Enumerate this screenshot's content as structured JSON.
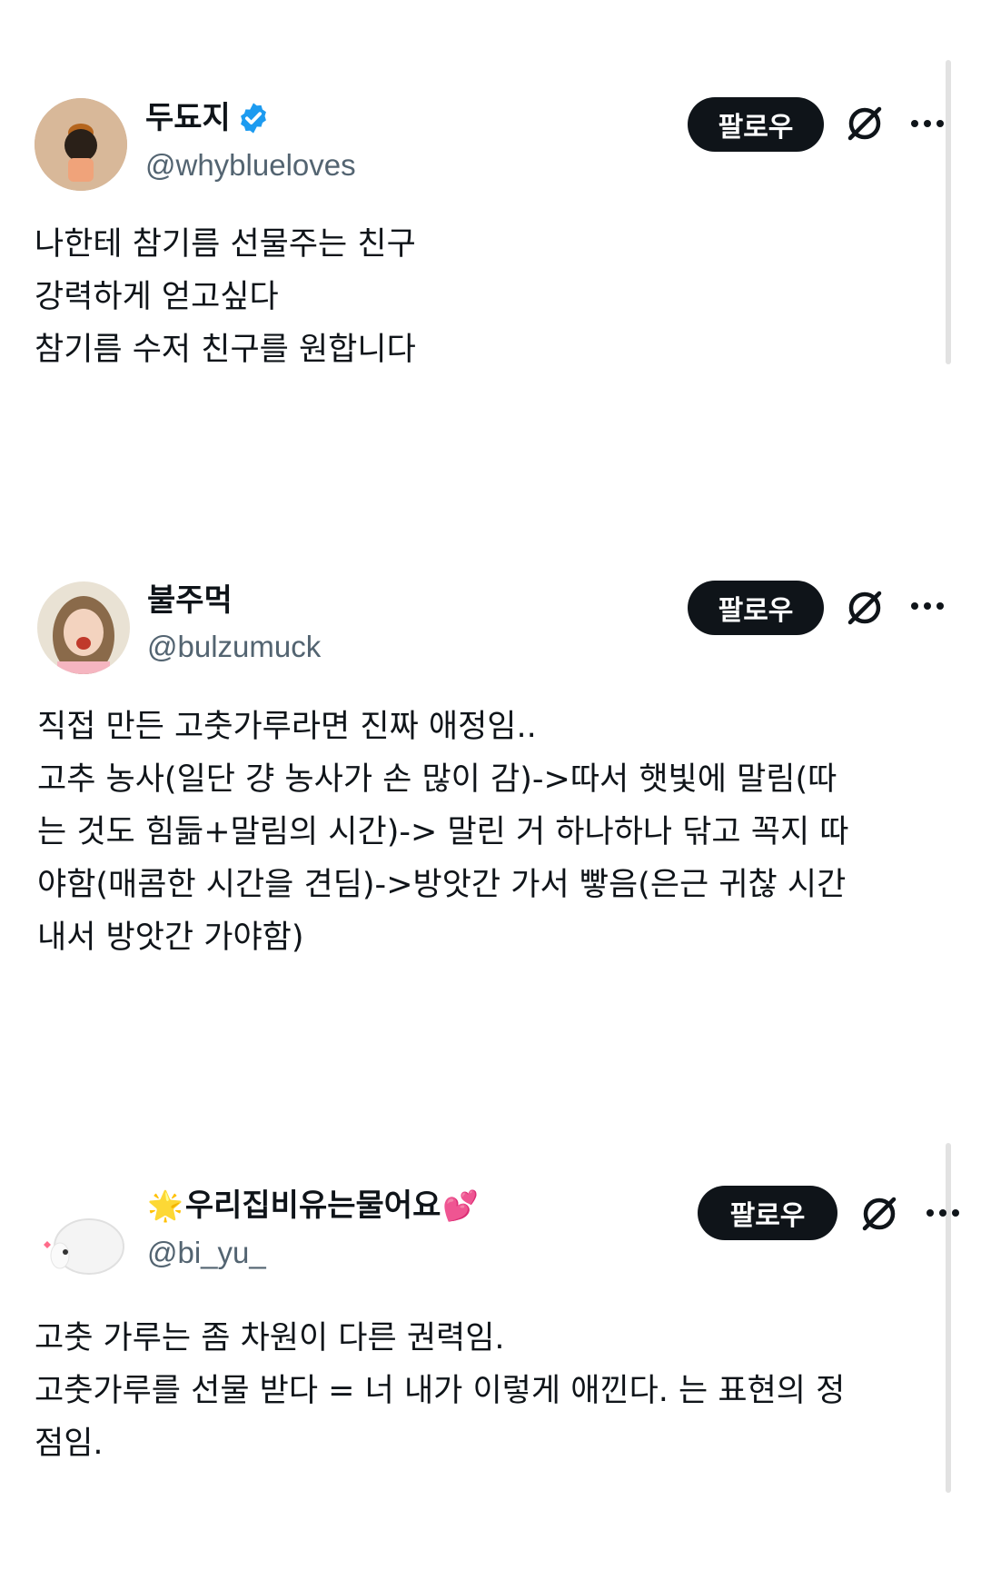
{
  "tweets": [
    {
      "name": "두됴지",
      "handle": "@whyblueloves",
      "verified": true,
      "follow_label": "팔로우",
      "lines": [
        "나한테 참기름 선물주는 친구",
        "강력하게 얻고싶다",
        "참기름 수저 친구를 원합니다"
      ]
    },
    {
      "name": "불주먹",
      "handle": "@bulzumuck",
      "verified": false,
      "follow_label": "팔로우",
      "lines": [
        "직접 만든 고춧가루라면 진짜 애정임..",
        "고추 농사(일단 걍 농사가 손 많이 감)->따서 햇빛에 말림(따",
        "는 것도 힘듦+말림의 시간)-> 말린 거 하나하나 닦고 꼭지 따",
        "야함(매콤한 시간을 견딤)->방앗간 가서 빻음(은근 귀찮 시간",
        "내서 방앗간 가야함)"
      ]
    },
    {
      "name": "우리집비유는물어요",
      "name_prefix_emoji": "🌟",
      "name_suffix_emoji": "💕",
      "handle": "@bi_yu_",
      "verified": false,
      "follow_label": "팔로우",
      "lines": [
        "고춧 가루는 좀 차원이 다른 권력임.",
        "고춧가루를 선물 받다 = 너 내가 이렇게 애낀다. 는 표현의 정",
        "점임."
      ]
    }
  ],
  "icons": {
    "verified": "verified-badge-icon",
    "grok": "grok-icon",
    "more": "more-horizontal-icon"
  },
  "colors": {
    "follow_bg": "#0f1419",
    "handle": "#536471",
    "verified": "#1d9bf0"
  }
}
